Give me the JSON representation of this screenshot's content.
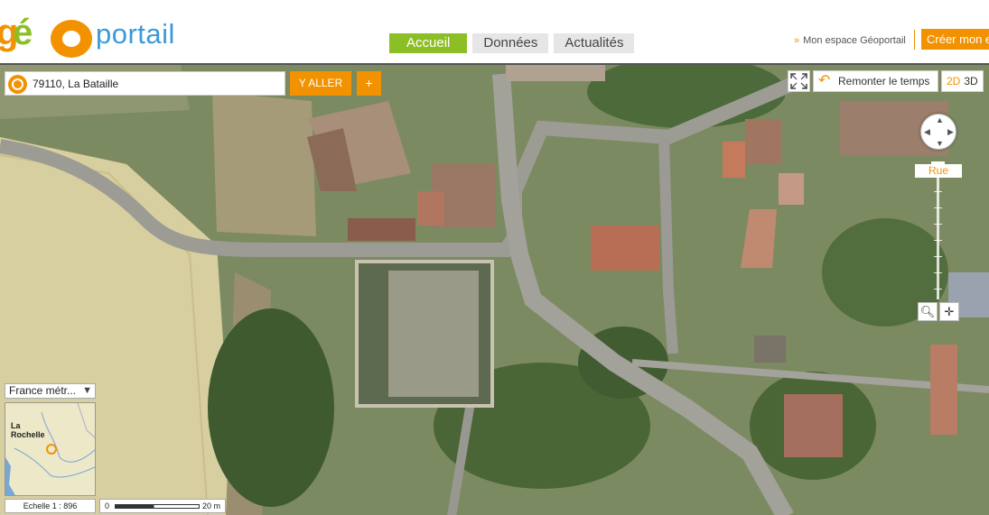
{
  "logo": {
    "g": "g",
    "e": "é",
    "word": "portail"
  },
  "nav": {
    "tabs": [
      "Accueil",
      "Données",
      "Actualités"
    ]
  },
  "header": {
    "espace_arrow": "»",
    "espace_label": "Mon espace Géoportail",
    "creer_label": "Créer mon e"
  },
  "search": {
    "value": "79110, La Bataille",
    "go_label": "Y ALLER",
    "plus_label": "+"
  },
  "controls": {
    "remonter_label": "Remonter le temps",
    "mode_2d": "2D",
    "mode_3d": "3D",
    "zoom_label": "Rue"
  },
  "minimap": {
    "region_select": "France métr...",
    "city_line1": "La",
    "city_line2": "Rochelle"
  },
  "scale": {
    "echelle": "Echelle 1 :  896",
    "start": "0",
    "end": "20 m"
  },
  "colors": {
    "accent_orange": "#f39200",
    "accent_green": "#8cbf26",
    "brand_blue": "#3a9ad9"
  }
}
